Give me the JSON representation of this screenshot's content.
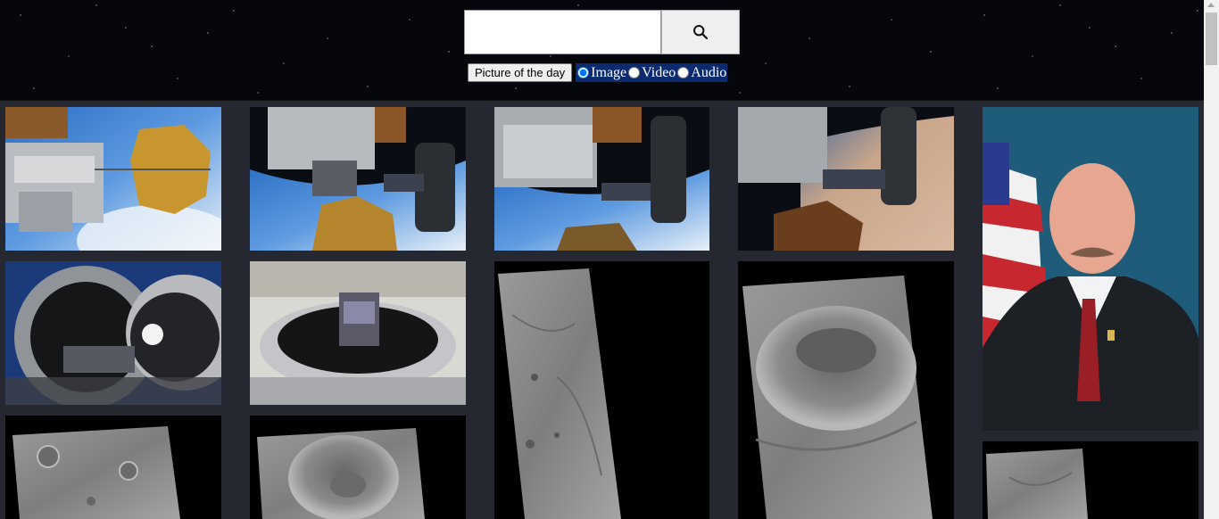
{
  "search": {
    "query": "",
    "placeholder": ""
  },
  "buttons": {
    "picture_of_the_day": "Picture of the day"
  },
  "media_types": {
    "selected": "Image",
    "options": [
      "Image",
      "Video",
      "Audio"
    ]
  },
  "icons": {
    "search": "search-icon"
  },
  "colors": {
    "page_background": "#252830",
    "radio_group_background": "#0b2a6f"
  },
  "gallery": [
    {
      "subject": "spacecraft-docking-earth"
    },
    {
      "subject": "spacecraft-docking-earth"
    },
    {
      "subject": "spacecraft-docking-earth"
    },
    {
      "subject": "spacecraft-docking-earth-desert"
    },
    {
      "subject": "official-portrait"
    },
    {
      "subject": "thermal-vacuum-chamber"
    },
    {
      "subject": "thermal-vacuum-chamber"
    },
    {
      "subject": "mars-surface-strip"
    },
    {
      "subject": "mars-crater-strip"
    },
    {
      "subject": "mars-craters-strip"
    },
    {
      "subject": "mars-crater-strip"
    },
    {
      "subject": "mars-surface-strip"
    }
  ]
}
